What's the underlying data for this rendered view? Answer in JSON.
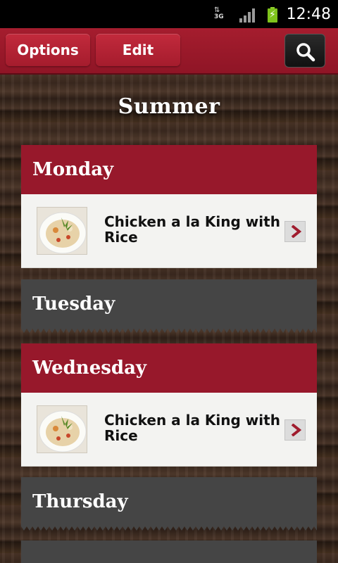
{
  "status_bar": {
    "network": "3G",
    "time": "12:48"
  },
  "toolbar": {
    "options_label": "Options",
    "edit_label": "Edit",
    "search_icon": "search-icon"
  },
  "page": {
    "title": "Summer"
  },
  "days": [
    {
      "label": "Monday",
      "style": "red",
      "meals": [
        {
          "name": "Chicken a la King with Rice"
        }
      ]
    },
    {
      "label": "Tuesday",
      "style": "gray",
      "meals": []
    },
    {
      "label": "Wednesday",
      "style": "red",
      "meals": [
        {
          "name": "Chicken a la King with Rice"
        }
      ]
    },
    {
      "label": "Thursday",
      "style": "gray",
      "meals": []
    }
  ],
  "colors": {
    "brand_red": "#97182b",
    "inactive_gray": "#454545",
    "status_bar": "#000000"
  }
}
